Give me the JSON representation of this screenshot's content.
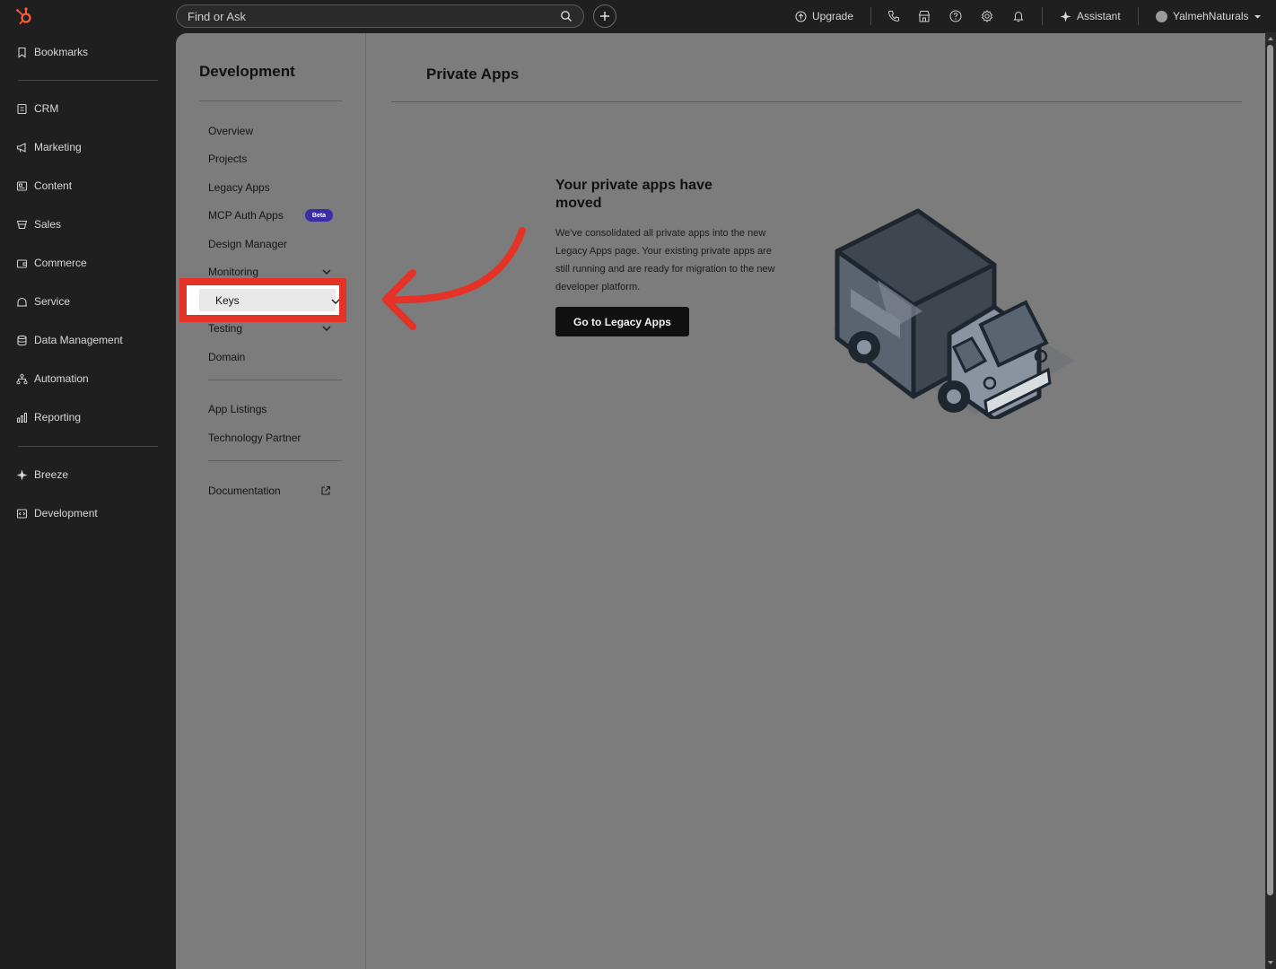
{
  "topbar": {
    "search_placeholder": "Find or Ask",
    "upgrade_label": "Upgrade",
    "assistant_label": "Assistant",
    "account_name": "YalmehNaturals"
  },
  "leftnav": {
    "bookmarks": "Bookmarks",
    "items": [
      {
        "label": "CRM",
        "icon": "crm-icon"
      },
      {
        "label": "Marketing",
        "icon": "megaphone-icon"
      },
      {
        "label": "Content",
        "icon": "content-icon"
      },
      {
        "label": "Sales",
        "icon": "sales-icon"
      },
      {
        "label": "Commerce",
        "icon": "wallet-icon"
      },
      {
        "label": "Service",
        "icon": "service-icon"
      },
      {
        "label": "Data Management",
        "icon": "database-icon"
      },
      {
        "label": "Automation",
        "icon": "automation-icon"
      },
      {
        "label": "Reporting",
        "icon": "chart-icon"
      }
    ],
    "breeze": "Breeze",
    "development": "Development"
  },
  "subnav": {
    "title": "Development",
    "items": {
      "overview": "Overview",
      "projects": "Projects",
      "legacy_apps": "Legacy Apps",
      "mcp_auth_apps": "MCP Auth Apps",
      "design_manager": "Design Manager",
      "monitoring": "Monitoring",
      "keys": "Keys",
      "testing": "Testing",
      "domain": "Domain",
      "app_listings": "App Listings",
      "technology_partner": "Technology Partner",
      "documentation": "Documentation"
    },
    "beta_badge": "Beta"
  },
  "main": {
    "page_title": "Private Apps",
    "message_title": "Your private apps have moved",
    "message_body": "We've consolidated all private apps into the new Legacy Apps page. Your existing private apps are still running and are ready for migration to the new developer platform.",
    "cta_label": "Go to Legacy Apps"
  },
  "colors": {
    "highlight": "#e53227",
    "beta_badge": "#3b2ca8",
    "brand_orange": "#ff5c35"
  }
}
